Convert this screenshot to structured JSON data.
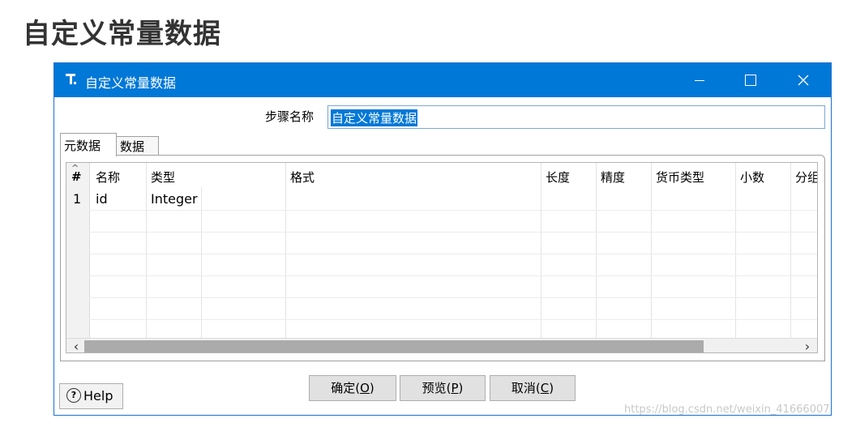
{
  "slide": {
    "title": "自定义常量数据"
  },
  "dialog": {
    "title": "自定义常量数据",
    "step_name_label": "步骤名称",
    "step_name_value": "自定义常量数据",
    "tabs": [
      {
        "label": "元数据",
        "active": true
      },
      {
        "label": "数据",
        "active": false
      }
    ],
    "table": {
      "headers": [
        "#",
        "名称",
        "类型",
        "格式",
        "长度",
        "精度",
        "货币类型",
        "小数",
        "分组"
      ],
      "rows": [
        {
          "num": "1",
          "name": "id",
          "type": "Integer"
        }
      ]
    },
    "buttons": {
      "ok_main": "确定(",
      "ok_key": "O",
      "ok_end": ")",
      "preview_main": "预览(",
      "preview_key": "P",
      "preview_end": ")",
      "cancel_main": "取消(",
      "cancel_key": "C",
      "cancel_end": ")"
    },
    "help_label": "Help"
  },
  "watermark": "https://blog.csdn.net/weixin_41666007",
  "colors": {
    "titlebar": "#0078d7",
    "selection": "#0078d7"
  }
}
